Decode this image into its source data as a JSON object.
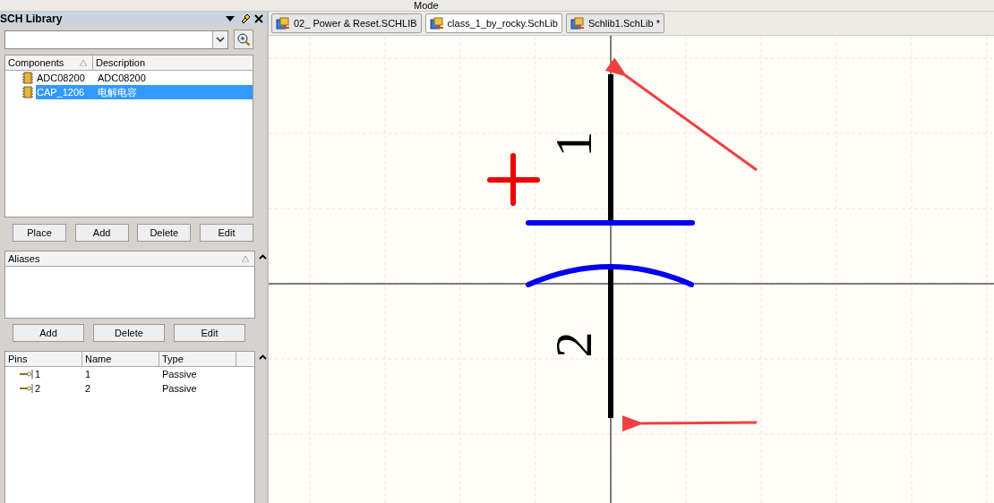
{
  "toolbar": {
    "mode_label": "Mode"
  },
  "panel": {
    "title": "SCH Library",
    "components": {
      "columns": [
        "Components",
        "Description"
      ],
      "rows": [
        {
          "name": "ADC08200",
          "description": "ADC08200",
          "selected": false
        },
        {
          "name": "CAP_1206",
          "description": "电解电容",
          "selected": true
        }
      ]
    },
    "component_buttons": [
      "Place",
      "Add",
      "Delete",
      "Edit"
    ],
    "aliases": {
      "columns": [
        "Aliases"
      ]
    },
    "alias_buttons": [
      "Add",
      "Delete",
      "Edit"
    ],
    "pins": {
      "columns": [
        "Pins",
        "Name",
        "Type"
      ],
      "rows": [
        {
          "pin": "1",
          "name": "1",
          "type": "Passive"
        },
        {
          "pin": "2",
          "name": "2",
          "type": "Passive"
        }
      ]
    }
  },
  "tabs": [
    {
      "label": "02_ Power & Reset.SCHLIB",
      "selected": false
    },
    {
      "label": "class_1_by_rocky.SchLib",
      "selected": true
    },
    {
      "label": "Schlib1.SchLib *",
      "selected": false
    }
  ],
  "canvas": {
    "pin_designators": [
      "1",
      "2"
    ]
  }
}
